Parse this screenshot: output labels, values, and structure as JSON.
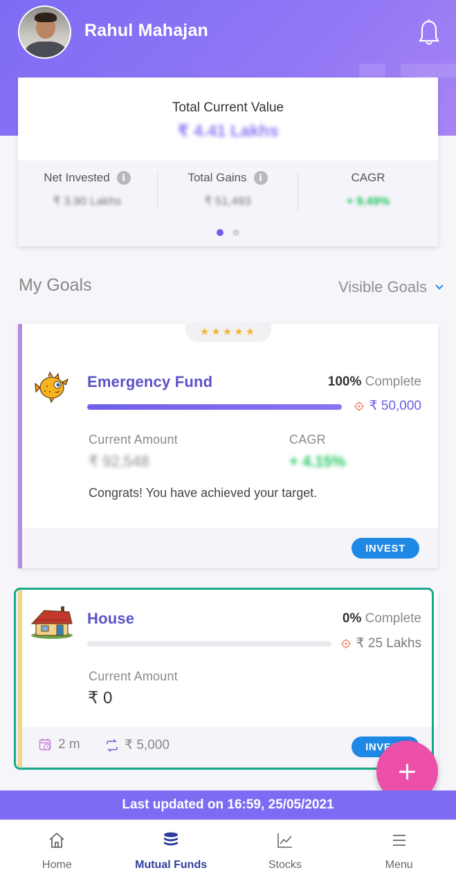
{
  "header": {
    "user_name": "Rahul Mahajan",
    "avatar_icon": "user-avatar",
    "notification_icon": "bell-icon"
  },
  "summary": {
    "total_label": "Total Current Value",
    "total_value": "₹ 4.41 Lakhs",
    "stats": [
      {
        "label": "Net Invested",
        "value": "₹ 3.90 Lakhs",
        "has_info": true
      },
      {
        "label": "Total Gains",
        "value": "₹ 51,493",
        "has_info": true
      },
      {
        "label": "CAGR",
        "value": "+ 9.49%",
        "has_info": false
      }
    ],
    "page_dots": {
      "count": 2,
      "active": 1
    }
  },
  "goals": {
    "title": "My Goals",
    "filter_label": "Visible Goals",
    "items": [
      {
        "name": "Emergency Fund",
        "icon": "pufferfish-icon",
        "rating": "★★★★★",
        "percent": "100%",
        "complete_label": "Complete",
        "progress": 1.0,
        "target": "₹ 50,000",
        "current_label": "Current Amount",
        "current_value": "₹ 92,548",
        "cagr_label": "CAGR",
        "cagr_value": "+ 4.15%",
        "message": "Congrats! You have achieved your target.",
        "invest_label": "INVEST",
        "accent": "#b38be0"
      },
      {
        "name": "House",
        "icon": "house-icon",
        "percent": "0%",
        "complete_label": "Complete",
        "progress": 0.0,
        "target": "₹ 25 Lakhs",
        "current_label": "Current Amount",
        "current_value": "₹ 0",
        "duration": "2 m",
        "sip_amount": "₹ 5,000",
        "invest_label": "INVEST",
        "accent": "#f5d48a"
      }
    ]
  },
  "fab_label": "+",
  "last_updated": "Last updated on 16:59, 25/05/2021",
  "nav": {
    "items": [
      {
        "label": "Home",
        "icon": "home-icon",
        "active": false
      },
      {
        "label": "Mutual Funds",
        "icon": "coins-icon",
        "active": true
      },
      {
        "label": "Stocks",
        "icon": "chart-icon",
        "active": false
      },
      {
        "label": "Menu",
        "icon": "menu-icon",
        "active": false
      }
    ]
  },
  "colors": {
    "header": "#7d6cf3",
    "accent_text": "#5a52c8",
    "invest_button": "#1e88e5",
    "fab": "#ec4fa8",
    "highlight": "#18a98b"
  }
}
